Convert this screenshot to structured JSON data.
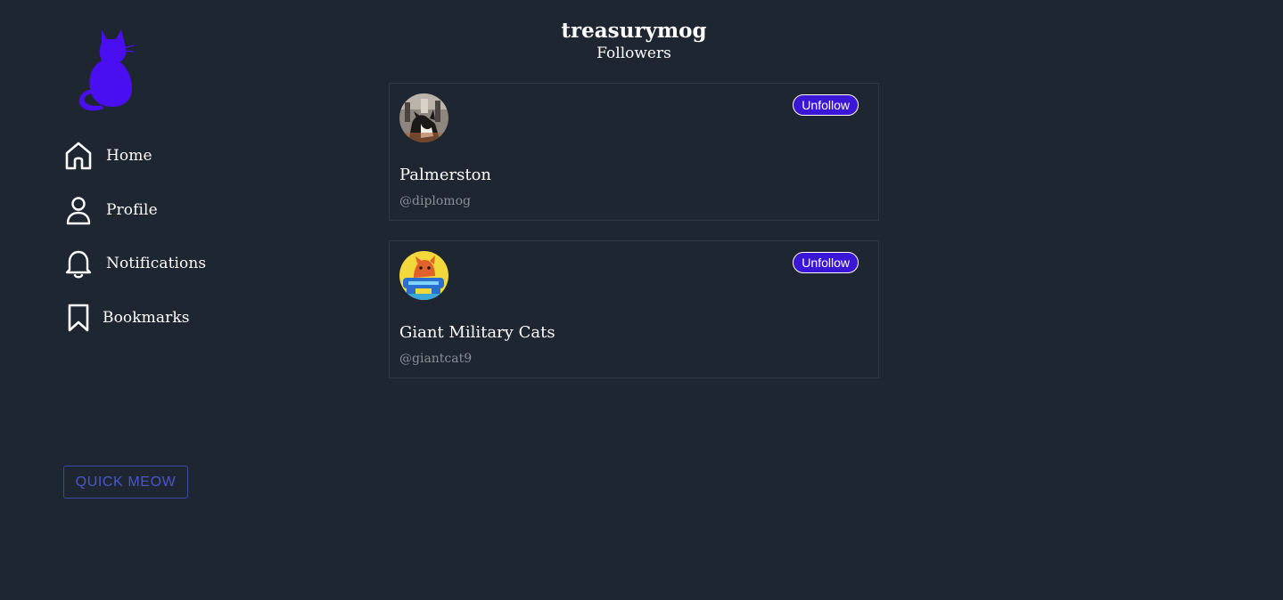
{
  "sidebar": {
    "nav": [
      {
        "label": "Home",
        "icon": "home-icon"
      },
      {
        "label": "Profile",
        "icon": "user-icon"
      },
      {
        "label": "Notifications",
        "icon": "bell-icon"
      },
      {
        "label": "Bookmarks",
        "icon": "bookmark-icon"
      }
    ],
    "quick_meow_label": "QUICK MEOW",
    "logo_color": "#4a0ff0"
  },
  "header": {
    "title": "treasurymog",
    "subtitle": "Followers"
  },
  "followers": [
    {
      "name": "Palmerston",
      "handle": "@diplomog",
      "button": "Unfollow"
    },
    {
      "name": "Giant Military Cats",
      "handle": "@giantcat9",
      "button": "Unfollow"
    }
  ],
  "colors": {
    "background": "#1e2632",
    "accent": "#3a16d6",
    "quick_meow": "#4b57c9"
  }
}
